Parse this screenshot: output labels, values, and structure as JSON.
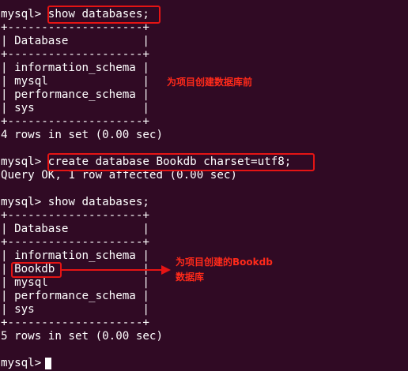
{
  "terminal": {
    "lines": [
      "mysql> show databases;",
      "+--------------------+",
      "| Database           |",
      "+--------------------+",
      "| information_schema |",
      "| mysql              |",
      "| performance_schema |",
      "| sys                |",
      "+--------------------+",
      "4 rows in set (0.00 sec)",
      "",
      "mysql> create database Bookdb charset=utf8;",
      "Query OK, 1 row affected (0.00 sec)",
      "",
      "mysql> show databases;",
      "+--------------------+",
      "| Database           |",
      "+--------------------+",
      "| information_schema |",
      "| Bookdb             |",
      "| mysql              |",
      "| performance_schema |",
      "| sys                |",
      "+--------------------+",
      "5 rows in set (0.00 sec)",
      "",
      "mysql> "
    ]
  },
  "annotations": {
    "note_before": "为项目创建数据库前",
    "note_after_line1": "为项目创建的Bookdb",
    "note_after_line2": "数据库"
  },
  "colors": {
    "background": "#300a24",
    "text": "#ffffff",
    "highlight": "#e51414",
    "annotation": "#ff2a1a"
  }
}
